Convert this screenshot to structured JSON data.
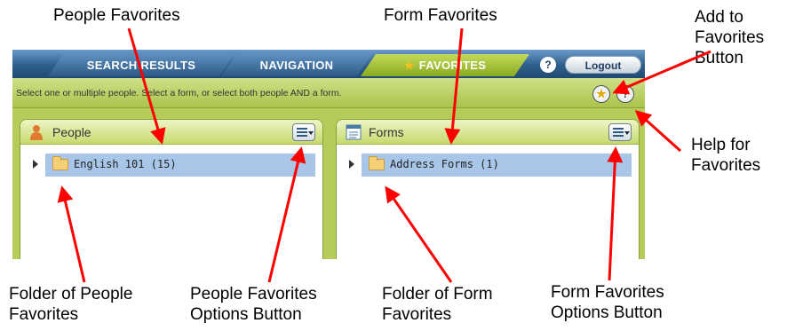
{
  "tabs": {
    "search_results": "SEARCH RESULTS",
    "navigation": "NAVIGATION",
    "favorites": "FAVORITES"
  },
  "top": {
    "help_glyph": "?",
    "logout": "Logout"
  },
  "instruction": "Select one or multiple people.  Select a form, or select both people AND a form.",
  "favorites_buttons": {
    "add_glyph": "★",
    "help_glyph": "?"
  },
  "people_panel": {
    "title": "People",
    "folder_label": "English 101 (15)"
  },
  "forms_panel": {
    "title": "Forms",
    "folder_label": "Address Forms (1)"
  },
  "annotations": {
    "people_favorites": "People Favorites",
    "form_favorites": "Form Favorites",
    "add_to_favorites": [
      "Add to",
      "Favorites",
      "Button"
    ],
    "help_for_favorites": [
      "Help for",
      "Favorites"
    ],
    "folder_of_people_favorites": [
      "Folder of People",
      "Favorites"
    ],
    "people_favorites_options": [
      "People Favorites",
      "Options Button"
    ],
    "folder_of_form_favorites": [
      "Folder of Form",
      "Favorites"
    ],
    "form_favorites_options": [
      "Form Favorites",
      "Options Button"
    ]
  },
  "colors": {
    "arrow": "#ff0000",
    "accent_green": "#b5cc5a",
    "header_blue": "#2e5f8c",
    "selection_blue": "#a7c6e8"
  },
  "icons": [
    "star-icon",
    "help-icon",
    "person-icon",
    "form-list-icon",
    "folder-icon",
    "options-menu-icon",
    "expand-arrow-icon"
  ]
}
